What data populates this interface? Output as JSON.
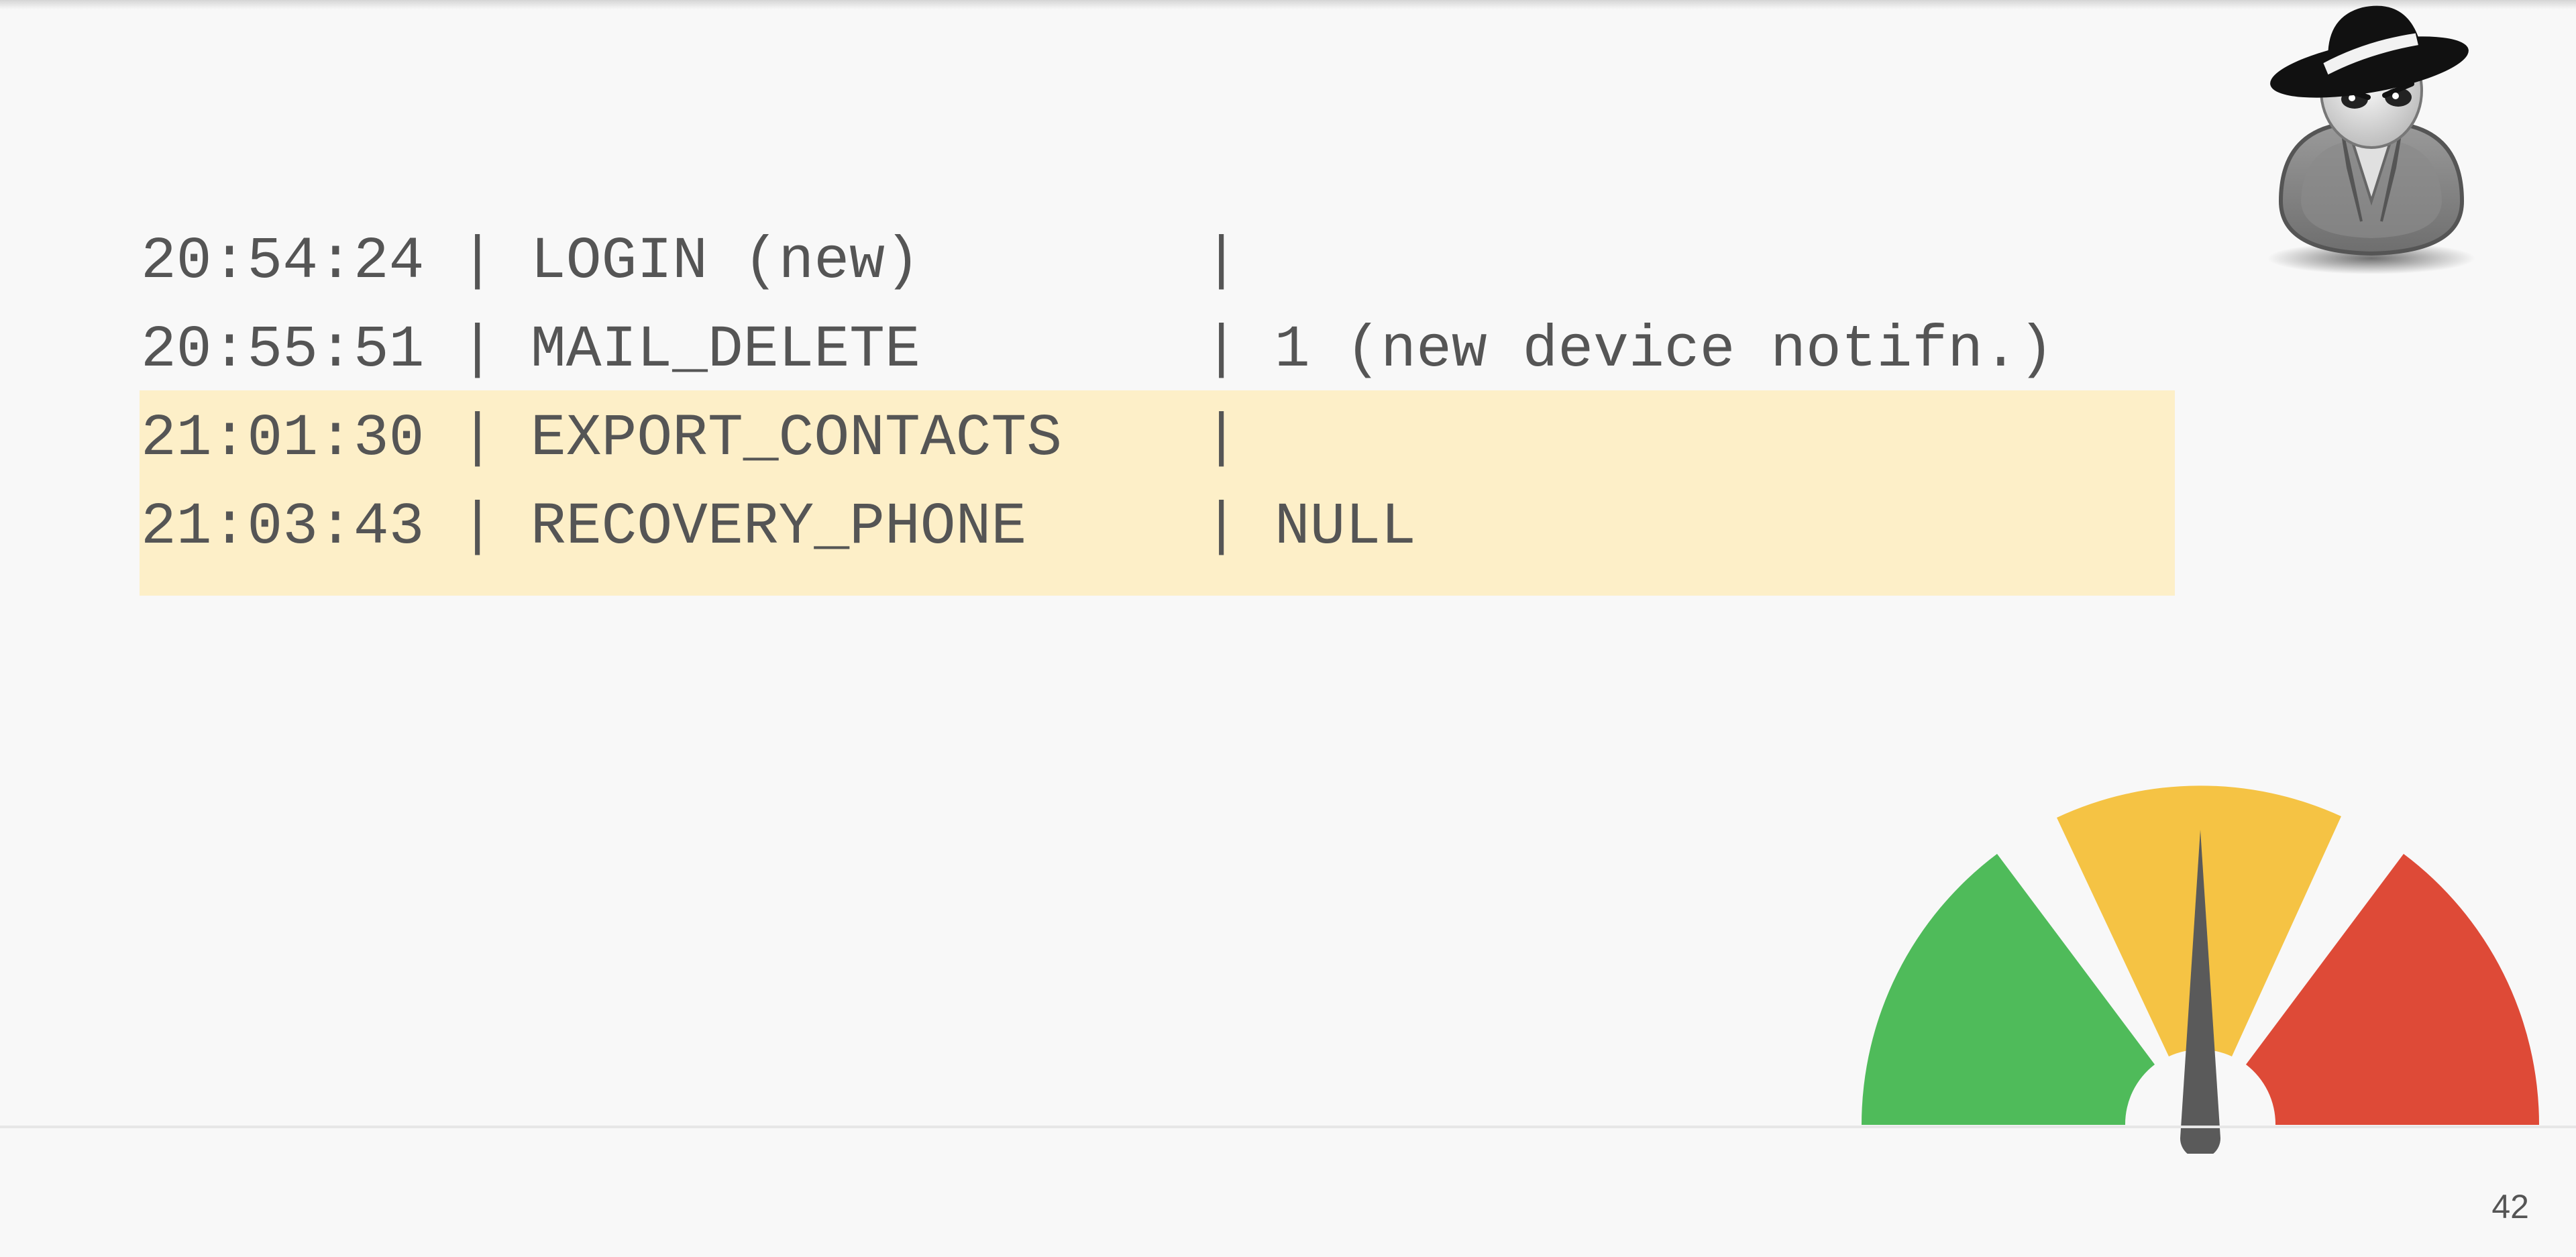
{
  "slide": {
    "page_number": "42"
  },
  "log": {
    "rows": [
      {
        "text": "20:54:24 | LOGIN (new)        |",
        "highlighted": false
      },
      {
        "text": "20:55:51 | MAIL_DELETE        | 1 (new device notifn.)",
        "highlighted": false
      },
      {
        "text": "21:01:30 | EXPORT_CONTACTS    |",
        "highlighted": true
      },
      {
        "text": "21:03:43 | RECOVERY_PHONE     | NULL",
        "highlighted": true
      }
    ]
  },
  "icons": {
    "spy": "spy-icon",
    "gauge": "risk-gauge-icon"
  },
  "gauge": {
    "level": 0.5,
    "segments": [
      "green",
      "yellow",
      "red"
    ]
  },
  "colors": {
    "background": "#f8f8f8",
    "text": "#555555",
    "highlight": "#fdefc8",
    "gauge_green": "#4fbb5a",
    "gauge_yellow": "#f5c344",
    "gauge_red": "#de4a37",
    "needle": "#5a5a5a"
  }
}
